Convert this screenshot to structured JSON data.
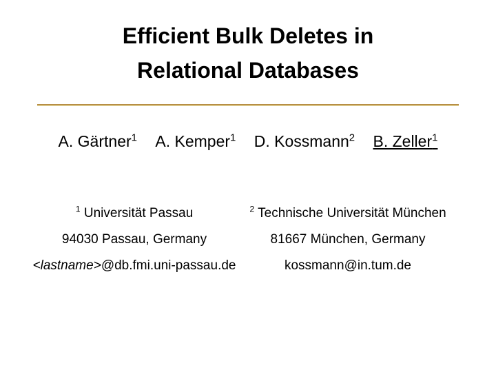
{
  "title_line1": "Efficient Bulk Deletes in",
  "title_line2": "Relational Databases",
  "authors": {
    "a1_name": "A. Gärtner",
    "a1_sup": "1",
    "a2_name": "A. Kemper",
    "a2_sup": "1",
    "a3_name": "D. Kossmann",
    "a3_sup": "2",
    "a4_name": "B. Zeller",
    "a4_sup": "1"
  },
  "affil1": {
    "sup": "1",
    "name": " Universität Passau",
    "addr": "94030 Passau, Germany",
    "email_prefix": "<lastname>",
    "email_suffix": "@db.fmi.uni-passau.de"
  },
  "affil2": {
    "sup": "2",
    "name": " Technische Universität München",
    "addr": "81667 München, Germany",
    "email": "kossmann@in.tum.de"
  }
}
